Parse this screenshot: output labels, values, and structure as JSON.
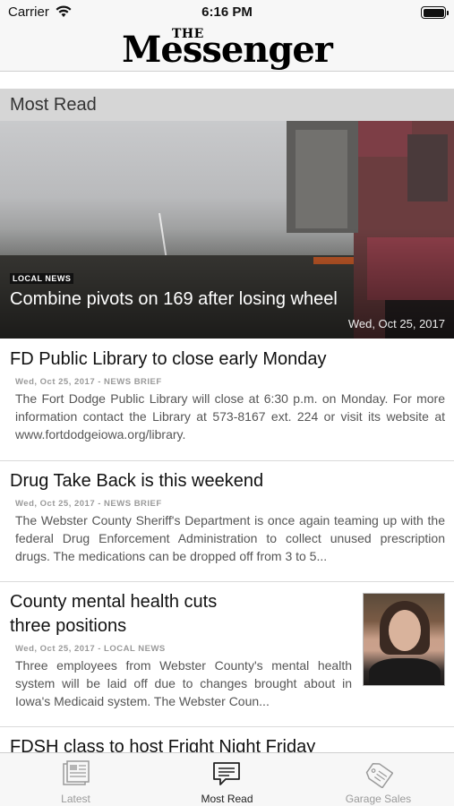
{
  "status_bar": {
    "carrier": "Carrier",
    "time": "6:16 PM"
  },
  "header": {
    "logo_the": "THE",
    "logo_name": "Messenger"
  },
  "section": {
    "title": "Most Read"
  },
  "hero": {
    "tag": "LOCAL NEWS",
    "title": "Combine pivots on 169 after losing wheel",
    "date": "Wed, Oct 25, 2017"
  },
  "articles": [
    {
      "title_lines": [
        "FD Public Library to close early Monday"
      ],
      "meta": "Wed, Oct 25, 2017 - NEWS BRIEF",
      "body": "The Fort Dodge Public Library will close at 6:30 p.m. on Monday. For more information contact the Library at 573-8167 ext. 224 or visit its website at www.fortdodgeiowa.org/library."
    },
    {
      "title_lines": [
        "Drug Take Back is this weekend"
      ],
      "meta": "Wed, Oct 25, 2017 - NEWS BRIEF",
      "body": "The Webster County Sheriff's Department is once again teaming up with the federal Drug Enforcement Administration to collect unused prescription drugs. The medications can be dropped off from 3 to 5..."
    },
    {
      "title_lines": [
        "County mental health cuts",
        "three positions"
      ],
      "meta": "Wed, Oct 25, 2017 - LOCAL NEWS",
      "body": "Three employees from Webster County's mental health system will be laid off due to changes brought about in Iowa's Medicaid system. The Webster Coun..."
    },
    {
      "title_lines": [
        "FDSH class to host Fright Night Friday"
      ]
    }
  ],
  "tabs": [
    {
      "label": "Latest",
      "icon": "newspaper-icon",
      "active": false
    },
    {
      "label": "Most Read",
      "icon": "message-icon",
      "active": true
    },
    {
      "label": "Garage Sales",
      "icon": "sale-tag-icon",
      "active": false
    }
  ],
  "colors": {
    "section_bg": "#d6d6d6",
    "active_tab": "#222222",
    "inactive_tab": "#9a9a9a"
  }
}
